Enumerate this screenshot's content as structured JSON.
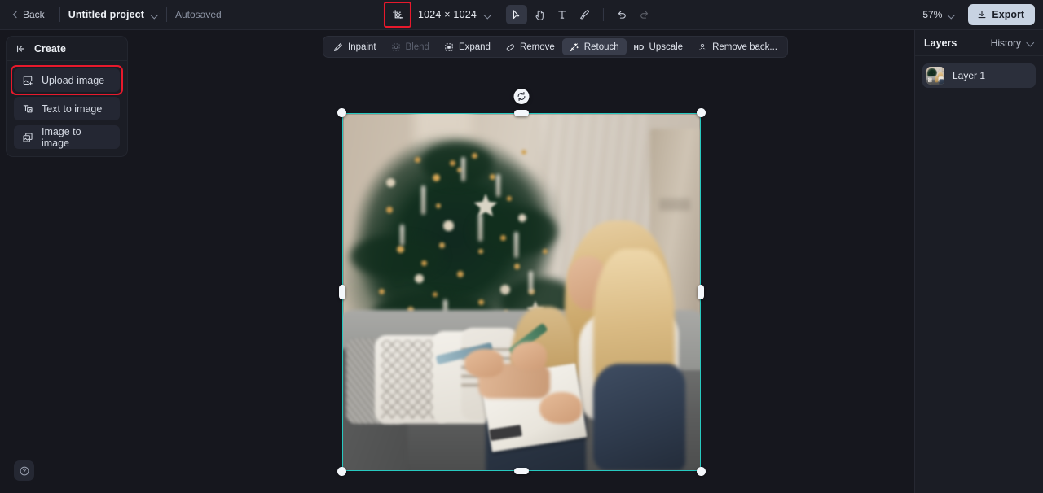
{
  "header": {
    "back_label": "Back",
    "project_name": "Untitled project",
    "autosaved_label": "Autosaved",
    "canvas_size": "1024 × 1024",
    "zoom_level": "57%",
    "export_label": "Export",
    "size_icon": "crop-resize-icon",
    "tools": [
      {
        "name": "select-tool",
        "icon": "cursor-arrow-icon",
        "active": true,
        "disabled": false
      },
      {
        "name": "pan-tool",
        "icon": "hand-icon",
        "active": false,
        "disabled": false
      },
      {
        "name": "text-tool",
        "icon": "text-t-icon",
        "active": false,
        "disabled": false
      },
      {
        "name": "brush-tool",
        "icon": "paintbrush-icon",
        "active": false,
        "disabled": false
      },
      {
        "name": "undo-button",
        "icon": "undo-arrow-icon",
        "active": false,
        "disabled": false
      },
      {
        "name": "redo-button",
        "icon": "redo-arrow-icon",
        "active": false,
        "disabled": true
      }
    ]
  },
  "sidebar": {
    "title": "Create",
    "collapse_icon": "collapse-panel-icon",
    "items": [
      {
        "label": "Upload image",
        "icon": "upload-image-icon",
        "highlighted": true
      },
      {
        "label": "Text to image",
        "icon": "text-to-image-icon",
        "highlighted": false
      },
      {
        "label": "Image to image",
        "icon": "image-to-image-icon",
        "highlighted": false
      }
    ]
  },
  "canvas_toolbar": {
    "items": [
      {
        "label": "Inpaint",
        "icon": "magic-wand-icon",
        "active": false,
        "disabled": false
      },
      {
        "label": "Blend",
        "icon": "blend-square-icon",
        "active": false,
        "disabled": true
      },
      {
        "label": "Expand",
        "icon": "expand-frame-icon",
        "active": false,
        "disabled": false
      },
      {
        "label": "Remove",
        "icon": "eraser-icon",
        "active": false,
        "disabled": false
      },
      {
        "label": "Retouch",
        "icon": "retouch-sparkle-icon",
        "active": true,
        "disabled": false
      },
      {
        "label": "Upscale",
        "icon": "hd-badge-icon",
        "badge": "HD",
        "active": false,
        "disabled": false
      },
      {
        "label": "Remove back...",
        "icon": "remove-background-person-icon",
        "active": false,
        "disabled": false
      }
    ]
  },
  "canvas": {
    "selection_color": "#27c9c0",
    "rotate_icon": "rotate-handle-icon",
    "image_alt": "Woman and child sitting on a gray couch writing on a clipboard in front of a decorated Christmas tree"
  },
  "right_panel": {
    "title": "Layers",
    "history_label": "History",
    "layers": [
      {
        "name": "Layer 1"
      }
    ]
  },
  "help": {
    "icon": "question-mark-circle-icon"
  },
  "colors": {
    "header_bg": "#1b1d25",
    "canvas_bg": "#16171e",
    "panel_bg": "#1b1d25",
    "accent_selection": "#27c9c0",
    "highlight_red": "#e8192c",
    "export_bg": "#c8d3e2"
  }
}
